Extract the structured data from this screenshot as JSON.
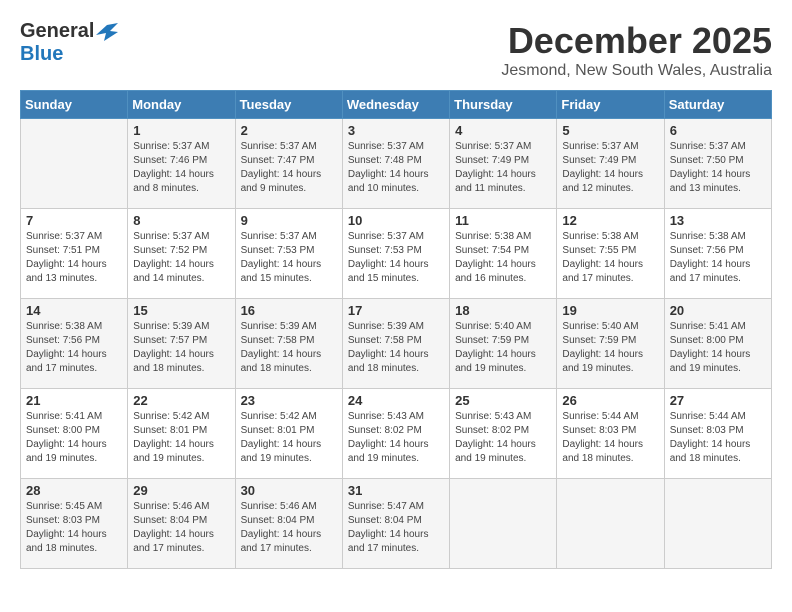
{
  "logo": {
    "general": "General",
    "blue": "Blue"
  },
  "title": {
    "month": "December 2025",
    "location": "Jesmond, New South Wales, Australia"
  },
  "days_of_week": [
    "Sunday",
    "Monday",
    "Tuesday",
    "Wednesday",
    "Thursday",
    "Friday",
    "Saturday"
  ],
  "weeks": [
    [
      {
        "day": "",
        "info": ""
      },
      {
        "day": "1",
        "info": "Sunrise: 5:37 AM\nSunset: 7:46 PM\nDaylight: 14 hours\nand 8 minutes."
      },
      {
        "day": "2",
        "info": "Sunrise: 5:37 AM\nSunset: 7:47 PM\nDaylight: 14 hours\nand 9 minutes."
      },
      {
        "day": "3",
        "info": "Sunrise: 5:37 AM\nSunset: 7:48 PM\nDaylight: 14 hours\nand 10 minutes."
      },
      {
        "day": "4",
        "info": "Sunrise: 5:37 AM\nSunset: 7:49 PM\nDaylight: 14 hours\nand 11 minutes."
      },
      {
        "day": "5",
        "info": "Sunrise: 5:37 AM\nSunset: 7:49 PM\nDaylight: 14 hours\nand 12 minutes."
      },
      {
        "day": "6",
        "info": "Sunrise: 5:37 AM\nSunset: 7:50 PM\nDaylight: 14 hours\nand 13 minutes."
      }
    ],
    [
      {
        "day": "7",
        "info": "Sunrise: 5:37 AM\nSunset: 7:51 PM\nDaylight: 14 hours\nand 13 minutes."
      },
      {
        "day": "8",
        "info": "Sunrise: 5:37 AM\nSunset: 7:52 PM\nDaylight: 14 hours\nand 14 minutes."
      },
      {
        "day": "9",
        "info": "Sunrise: 5:37 AM\nSunset: 7:53 PM\nDaylight: 14 hours\nand 15 minutes."
      },
      {
        "day": "10",
        "info": "Sunrise: 5:37 AM\nSunset: 7:53 PM\nDaylight: 14 hours\nand 15 minutes."
      },
      {
        "day": "11",
        "info": "Sunrise: 5:38 AM\nSunset: 7:54 PM\nDaylight: 14 hours\nand 16 minutes."
      },
      {
        "day": "12",
        "info": "Sunrise: 5:38 AM\nSunset: 7:55 PM\nDaylight: 14 hours\nand 17 minutes."
      },
      {
        "day": "13",
        "info": "Sunrise: 5:38 AM\nSunset: 7:56 PM\nDaylight: 14 hours\nand 17 minutes."
      }
    ],
    [
      {
        "day": "14",
        "info": "Sunrise: 5:38 AM\nSunset: 7:56 PM\nDaylight: 14 hours\nand 17 minutes."
      },
      {
        "day": "15",
        "info": "Sunrise: 5:39 AM\nSunset: 7:57 PM\nDaylight: 14 hours\nand 18 minutes."
      },
      {
        "day": "16",
        "info": "Sunrise: 5:39 AM\nSunset: 7:58 PM\nDaylight: 14 hours\nand 18 minutes."
      },
      {
        "day": "17",
        "info": "Sunrise: 5:39 AM\nSunset: 7:58 PM\nDaylight: 14 hours\nand 18 minutes."
      },
      {
        "day": "18",
        "info": "Sunrise: 5:40 AM\nSunset: 7:59 PM\nDaylight: 14 hours\nand 19 minutes."
      },
      {
        "day": "19",
        "info": "Sunrise: 5:40 AM\nSunset: 7:59 PM\nDaylight: 14 hours\nand 19 minutes."
      },
      {
        "day": "20",
        "info": "Sunrise: 5:41 AM\nSunset: 8:00 PM\nDaylight: 14 hours\nand 19 minutes."
      }
    ],
    [
      {
        "day": "21",
        "info": "Sunrise: 5:41 AM\nSunset: 8:00 PM\nDaylight: 14 hours\nand 19 minutes."
      },
      {
        "day": "22",
        "info": "Sunrise: 5:42 AM\nSunset: 8:01 PM\nDaylight: 14 hours\nand 19 minutes."
      },
      {
        "day": "23",
        "info": "Sunrise: 5:42 AM\nSunset: 8:01 PM\nDaylight: 14 hours\nand 19 minutes."
      },
      {
        "day": "24",
        "info": "Sunrise: 5:43 AM\nSunset: 8:02 PM\nDaylight: 14 hours\nand 19 minutes."
      },
      {
        "day": "25",
        "info": "Sunrise: 5:43 AM\nSunset: 8:02 PM\nDaylight: 14 hours\nand 19 minutes."
      },
      {
        "day": "26",
        "info": "Sunrise: 5:44 AM\nSunset: 8:03 PM\nDaylight: 14 hours\nand 18 minutes."
      },
      {
        "day": "27",
        "info": "Sunrise: 5:44 AM\nSunset: 8:03 PM\nDaylight: 14 hours\nand 18 minutes."
      }
    ],
    [
      {
        "day": "28",
        "info": "Sunrise: 5:45 AM\nSunset: 8:03 PM\nDaylight: 14 hours\nand 18 minutes."
      },
      {
        "day": "29",
        "info": "Sunrise: 5:46 AM\nSunset: 8:04 PM\nDaylight: 14 hours\nand 17 minutes."
      },
      {
        "day": "30",
        "info": "Sunrise: 5:46 AM\nSunset: 8:04 PM\nDaylight: 14 hours\nand 17 minutes."
      },
      {
        "day": "31",
        "info": "Sunrise: 5:47 AM\nSunset: 8:04 PM\nDaylight: 14 hours\nand 17 minutes."
      },
      {
        "day": "",
        "info": ""
      },
      {
        "day": "",
        "info": ""
      },
      {
        "day": "",
        "info": ""
      }
    ]
  ]
}
